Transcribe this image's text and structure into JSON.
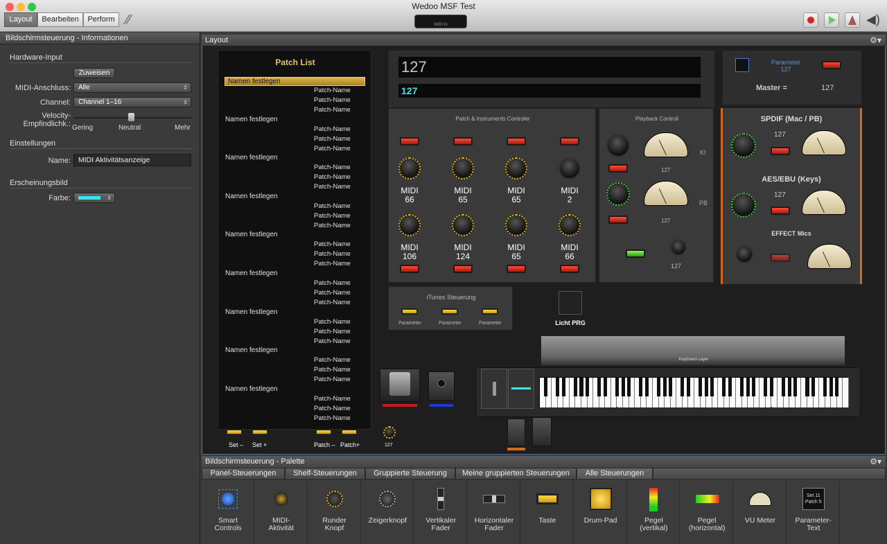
{
  "window": {
    "title": "Wedoo MSF Test",
    "midi_in": "MIDI In"
  },
  "modes": [
    "Layout",
    "Bearbeiten",
    "Perform"
  ],
  "inspector": {
    "header": "Bildschirmsteuerung - Informationen",
    "hardware_title": "Hardware-Input",
    "assign": "Zuweisen",
    "midi_port_label": "MIDI-Anschluss:",
    "midi_port_value": "Alle",
    "channel_label": "Channel:",
    "channel_value": "Channel 1–16",
    "velocity_label1": "Velocity-",
    "velocity_label2": "Empfindlichk.:",
    "vel_low": "Gering",
    "vel_mid": "Neutral",
    "vel_high": "Mehr",
    "settings_title": "Einstellungen",
    "name_label": "Name:",
    "name_value": "MIDI Aktivitätsanzeige",
    "appearance_title": "Erscheinungsbild",
    "color_label": "Farbe:",
    "color_value": "#39e6f0"
  },
  "layout": {
    "header": "Layout",
    "patch_list_title": "Patch List",
    "group_label": "Namen festlegen",
    "patch_name": "Patch-Name",
    "patch_buttons": [
      "Set –",
      "Set +",
      "Patch –",
      "Patch+"
    ],
    "display_big": "127",
    "display_small": "127",
    "parameter_label": "Parameter",
    "parameter_value": "127",
    "master_label": "Master  =",
    "master_value": "127",
    "instr_title": "Patch & Instruments Controler",
    "midi_top": [
      "66",
      "65",
      "65",
      "2"
    ],
    "midi_bottom": [
      "106",
      "124",
      "65",
      "66"
    ],
    "midi_word": "MIDI",
    "playback_title": "Playback Controll",
    "ki": "KI",
    "pb": "PB",
    "pb_val1": "127",
    "pb_val2": "127",
    "pb_val3": "127",
    "spdif_title": "SPDIF (Mac / PB)",
    "spdif_val": "127",
    "aes_title": "AES/EBU (Keys)",
    "aes_val": "127",
    "effect_title": "EFFECT Mics",
    "itunes_title": "iTunes Steuerung",
    "itunes_param": "Parameter",
    "licht": "Licht PRG",
    "keyboard_layer": "Keyboard-Layer",
    "knob_val": "127"
  },
  "palette": {
    "header": "Bildschirmsteuerung - Palette",
    "tabs": [
      "Panel-Steuerungen",
      "Shelf-Steuerungen",
      "Gruppierte Steuerung",
      "Meine gruppierten Steuerungen",
      "Alle Steuerungen"
    ],
    "items": [
      [
        "Smart",
        "Controls"
      ],
      [
        "MIDI-",
        "Aktivität"
      ],
      [
        "Runder",
        "Knopf"
      ],
      [
        "Zeigerknopf",
        ""
      ],
      [
        "Vertikaler",
        "Fader"
      ],
      [
        "Horizontaler",
        "Fader"
      ],
      [
        "Taste",
        ""
      ],
      [
        "Drum-Pad",
        ""
      ],
      [
        "Pegel",
        "(vertikal)"
      ],
      [
        "Pegel",
        "(horizontal)"
      ],
      [
        "VU Meter",
        ""
      ],
      [
        "Parameter-",
        "Text"
      ]
    ],
    "param_icon_line1": "Set 11",
    "param_icon_line2": "Patch 5"
  }
}
